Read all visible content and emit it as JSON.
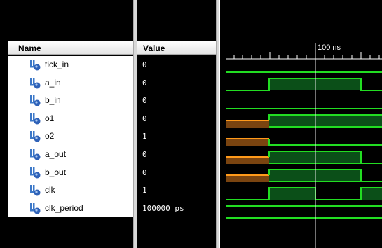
{
  "columns": {
    "name_header": "Name",
    "value_header": "Value"
  },
  "timeline": {
    "marker_label": "100 ns"
  },
  "signals": [
    {
      "name": "tick_in",
      "value": "0"
    },
    {
      "name": "a_in",
      "value": "0"
    },
    {
      "name": "b_in",
      "value": "0"
    },
    {
      "name": "o1",
      "value": "0"
    },
    {
      "name": "o2",
      "value": "1"
    },
    {
      "name": "a_out",
      "value": "0"
    },
    {
      "name": "b_out",
      "value": "0"
    },
    {
      "name": "clk",
      "value": "1"
    },
    {
      "name": "clk_period",
      "value": "100000 ps"
    }
  ],
  "colors": {
    "wave_green": "#22dd22",
    "wave_fill": "#0b4f18",
    "wave_orange": "#ff9a1a",
    "cursor": "#e8e8e8",
    "background": "#000000"
  },
  "icons": {
    "signal_icon": "logic-signal-icon"
  }
}
